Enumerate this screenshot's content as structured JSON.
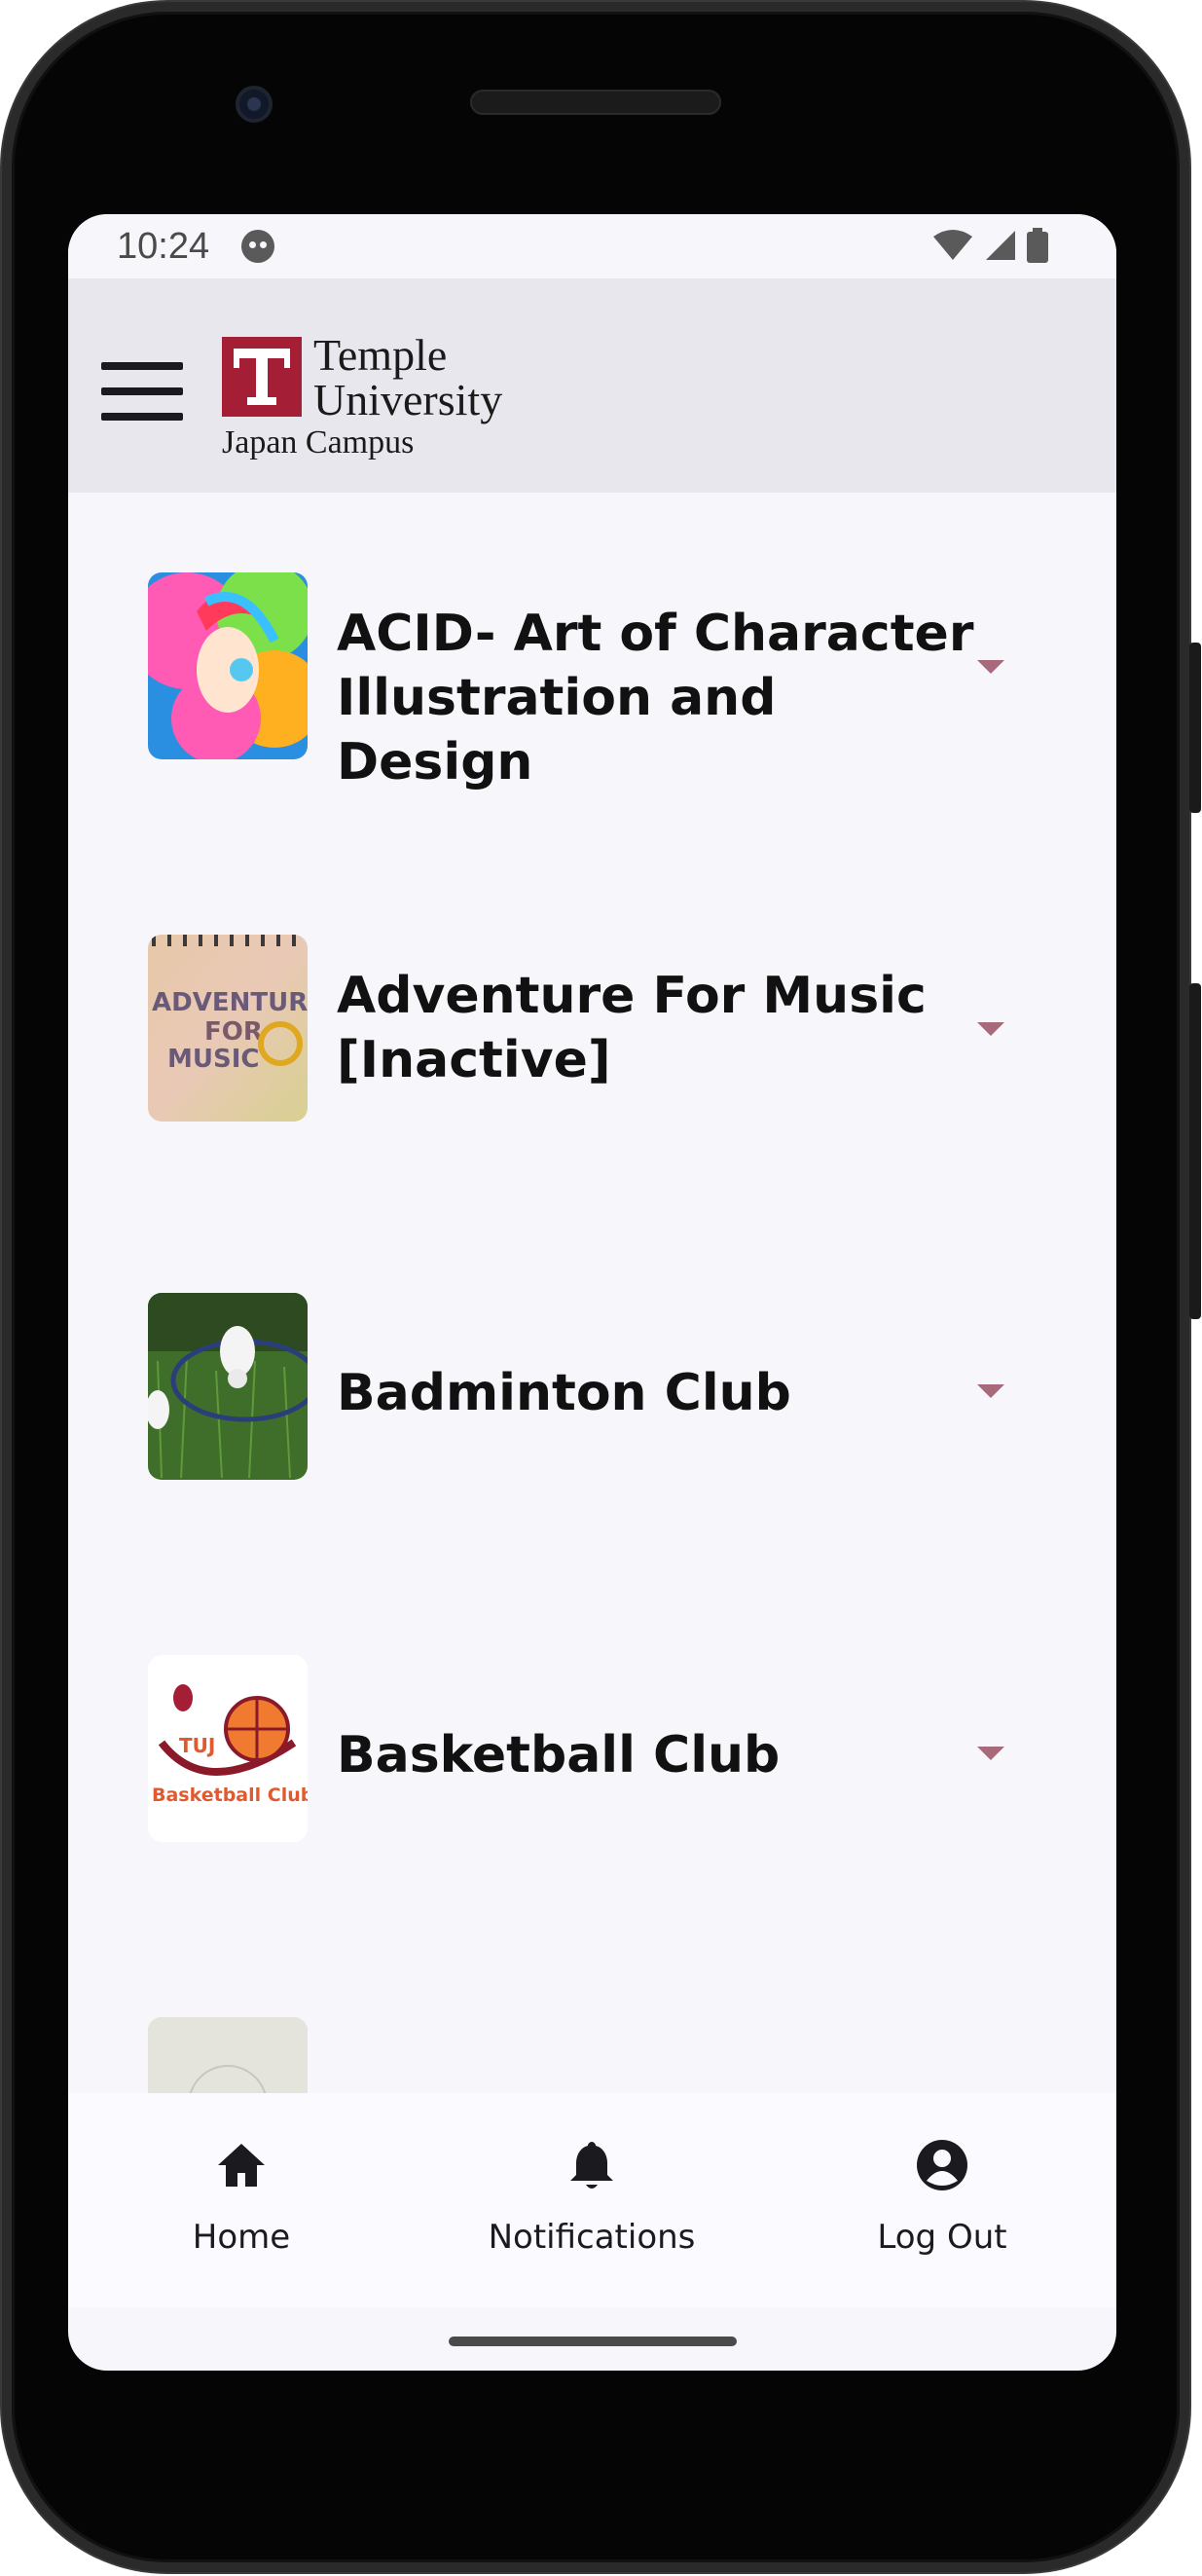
{
  "status_bar": {
    "time": "10:24"
  },
  "header": {
    "logo_line1": "Temple",
    "logo_line2": "University",
    "logo_sub": "Japan Campus"
  },
  "clubs": [
    {
      "name": "ACID- Art of Character Illustration and Design"
    },
    {
      "name": "Adventure For Music [Inactive]"
    },
    {
      "name": "Badminton Club"
    },
    {
      "name": "Basketball Club"
    }
  ],
  "thumbnails": {
    "adventure_text1": "ADVENTURE",
    "adventure_text2": "FOR",
    "adventure_text3": "MUSIC",
    "basketball_tuj": "TUJ",
    "basketball_label": "Basketball Club"
  },
  "bottom_nav": {
    "home": "Home",
    "notifications": "Notifications",
    "logout": "Log Out"
  },
  "colors": {
    "brand": "#a41e35",
    "accent_arrow": "#a8697a",
    "header_bg": "#e8e7ee",
    "screen_bg": "#f7f6fb"
  }
}
